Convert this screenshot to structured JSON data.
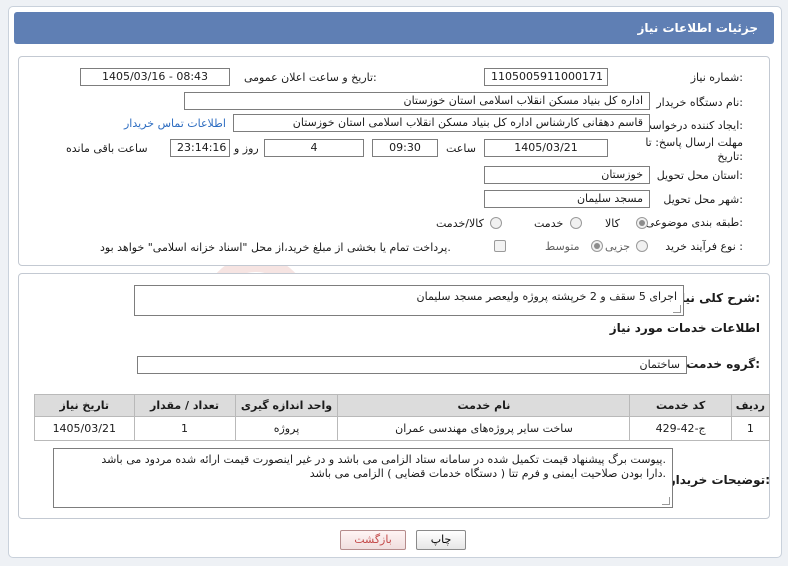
{
  "header": {
    "title": "جزئیات اطلاعات نیاز"
  },
  "fields": {
    "need_number_label": "شماره نیاز:",
    "need_number": "1105005911000171",
    "announce_label": "تاریخ و ساعت اعلان عمومی:",
    "announce_value": "1405/03/16 - 08:43",
    "buyer_org_label": "نام دستگاه خریدار:",
    "buyer_org": "اداره کل بنیاد مسکن انقلاب اسلامی استان خوزستان",
    "creator_label": "ایجاد کننده درخواست:",
    "creator": "قاسم دهقانی کارشناس اداره کل بنیاد مسکن انقلاب اسلامی استان خوزستان",
    "contact_link": "اطلاعات تماس خریدار",
    "deadline_label": "مهلت ارسال پاسخ: تا تاریخ:",
    "deadline_date": "1405/03/21",
    "time_label": "ساعت",
    "deadline_time": "09:30",
    "days_value": "4",
    "days_label": "روز و",
    "remaining_time": "23:14:16",
    "remaining_label": "ساعت باقی مانده",
    "province_label": "استان محل تحویل:",
    "province": "خوزستان",
    "city_label": "شهر محل تحویل:",
    "city": "مسجد سلیمان",
    "category_label": "طبقه بندی موضوعی:",
    "category_options": [
      "کالا",
      "خدمت",
      "کالا/خدمت"
    ],
    "process_label": "نوع فرآیند خرید :",
    "process_options": [
      "جزیی",
      "متوسط"
    ],
    "payment_note": "پرداخت تمام یا بخشی از مبلغ خرید،از محل \"اسناد خزانه اسلامی\" خواهد بود."
  },
  "description": {
    "label": "شرح کلی نیاز:",
    "value": "اجرای  5 سقف و 2 خرپشته  پروژه ولیعصر مسجد سلیمان"
  },
  "services": {
    "section_title": "اطلاعات خدمات مورد نیاز",
    "group_label": "گروه خدمت:",
    "group_value": "ساختمان",
    "columns": [
      "ردیف",
      "کد خدمت",
      "نام خدمت",
      "واحد اندازه گیری",
      "تعداد / مقدار",
      "تاریخ نیاز"
    ],
    "rows": [
      [
        "1",
        "ج-42-429",
        "ساخت سایر پروژه‌های مهندسی عمران",
        "پروژه",
        "1",
        "1405/03/21"
      ]
    ]
  },
  "buyer_notes": {
    "label": "توضیحات خریدار:",
    "line1": "پیوست برگ پیشنهاد قیمت تکمیل شده در سامانه ستاد الزامی می باشد و در غیر اینصورت  قیمت ارائه شده مردود می باشد.",
    "line2": "دارا بودن صلاحیت ایمنی و فرم تتا ( دستگاه خدمات قضایی ) الزامی می باشد."
  },
  "buttons": {
    "print": "چاپ",
    "back": "بازگشت"
  },
  "colors": {
    "header": "#5f7fb4",
    "link": "#2e6dc1",
    "back_text": "#c44a4a"
  }
}
